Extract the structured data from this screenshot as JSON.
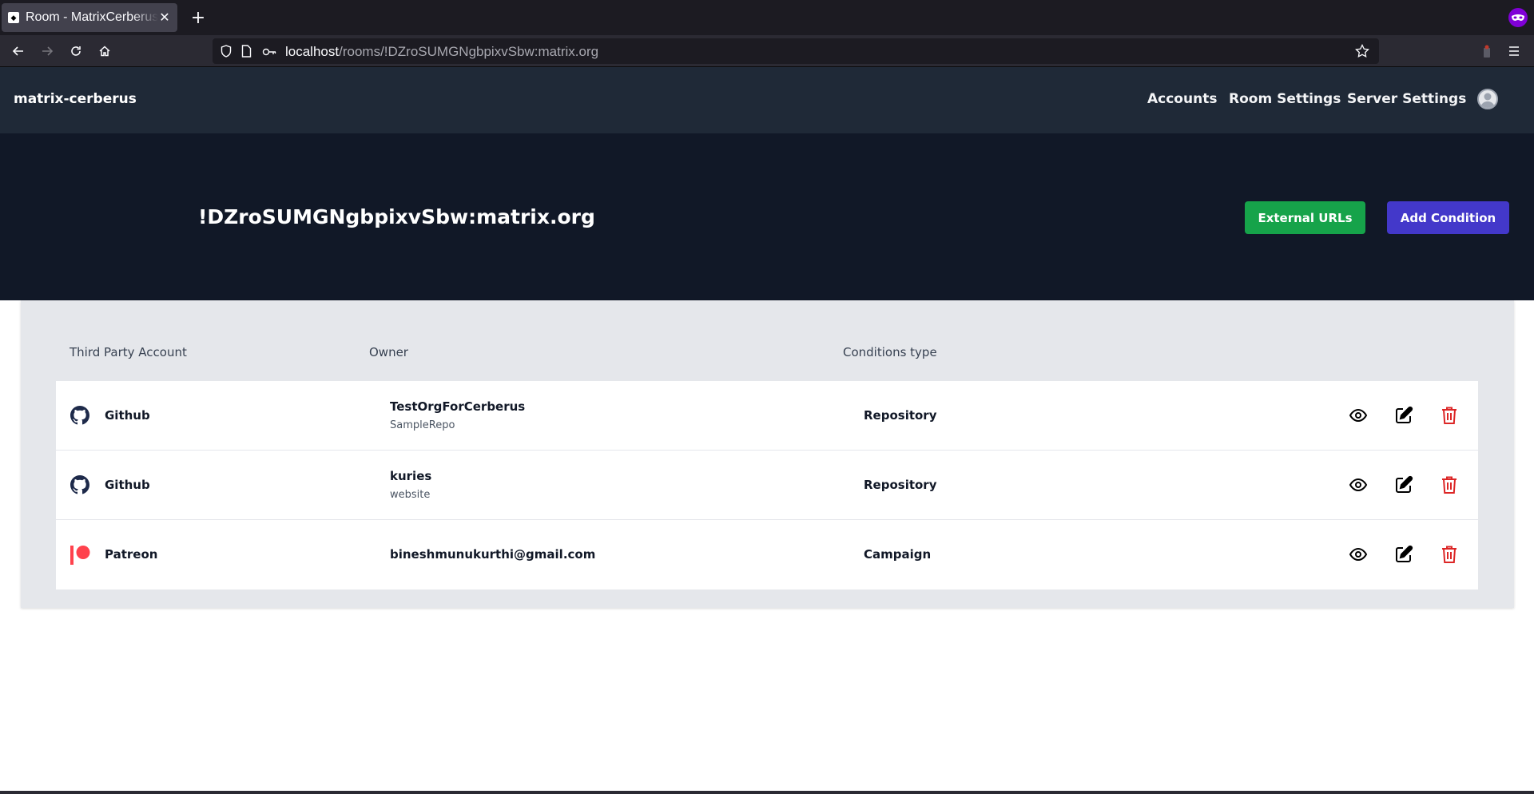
{
  "browser": {
    "tab_title": "Room - MatrixCerberus",
    "new_tab_symbol": "+",
    "url_host": "localhost",
    "url_path": "/rooms/!DZroSUMGNgbpixvSbw:matrix.org"
  },
  "app": {
    "brand": "matrix-cerberus",
    "nav": {
      "accounts": "Accounts",
      "room_settings": "Room Settings",
      "server_settings": "Server Settings"
    }
  },
  "hero": {
    "room_id": "!DZroSUMGNgbpixvSbw:matrix.org",
    "external_urls_label": "External URLs",
    "add_condition_label": "Add Condition"
  },
  "table": {
    "headers": {
      "account": "Third Party Account",
      "owner": "Owner",
      "type": "Conditions type"
    },
    "rows": [
      {
        "provider": "Github",
        "provider_icon": "github-icon",
        "owner": "TestOrgForCerberus",
        "owner_sub": "SampleRepo",
        "type": "Repository"
      },
      {
        "provider": "Github",
        "provider_icon": "github-icon",
        "owner": "kuries",
        "owner_sub": "website",
        "type": "Repository"
      },
      {
        "provider": "Patreon",
        "provider_icon": "patreon-icon",
        "owner": "bineshmunukurthi@gmail.com",
        "owner_sub": "",
        "type": "Campaign"
      }
    ]
  },
  "colors": {
    "app_header": "#1f2937",
    "hero": "#111827",
    "green_button": "#16a34a",
    "indigo_button": "#4338ca",
    "delete_red": "#dc2626",
    "patreon": "#ff424d",
    "github": "#1e2a4a"
  }
}
